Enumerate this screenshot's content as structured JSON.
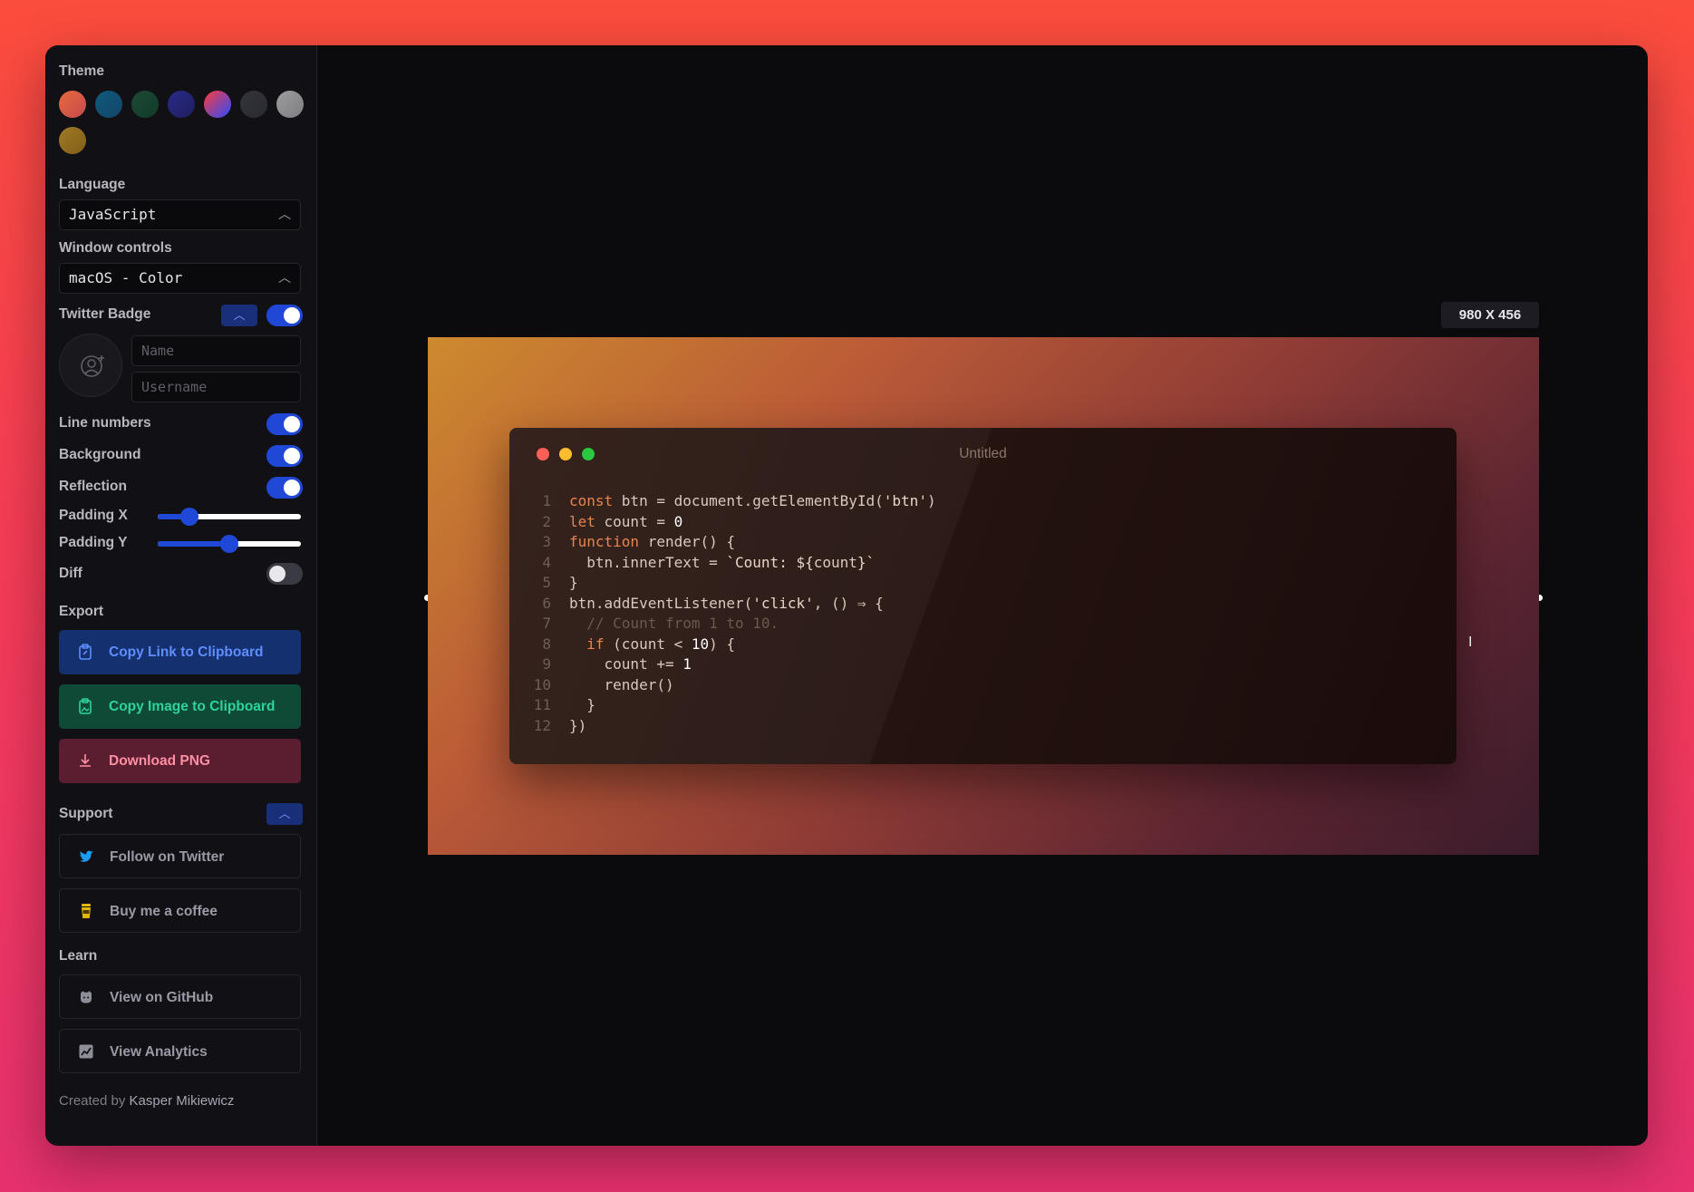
{
  "sidebar": {
    "theme_label": "Theme",
    "theme_swatches": [
      {
        "name": "candy",
        "colors": [
          "#e8693d",
          "#c54a4e"
        ]
      },
      {
        "name": "ocean",
        "colors": [
          "#0f5a7a",
          "#13456a"
        ]
      },
      {
        "name": "forest",
        "colors": [
          "#1c4a34",
          "#123a2a"
        ]
      },
      {
        "name": "midnight",
        "colors": [
          "#2a2a8a",
          "#1e1e5e"
        ]
      },
      {
        "name": "rainbow",
        "colors": [
          "#ff3b3b",
          "#2b4bff"
        ]
      },
      {
        "name": "slate",
        "colors": [
          "#33343a",
          "#2a2b30"
        ]
      },
      {
        "name": "silver",
        "colors": [
          "#9d9d9f",
          "#7e7e82"
        ]
      },
      {
        "name": "gold",
        "colors": [
          "#a07a27",
          "#7f5e18"
        ]
      }
    ],
    "language_label": "Language",
    "language_value": "JavaScript",
    "window_controls_label": "Window controls",
    "window_controls_value": "macOS - Color",
    "twitter_badge_label": "Twitter Badge",
    "name_placeholder": "Name",
    "username_placeholder": "Username",
    "line_numbers_label": "Line numbers",
    "background_label": "Background",
    "reflection_label": "Reflection",
    "padding_x_label": "Padding X",
    "padding_y_label": "Padding Y",
    "padding_x_value": 0.22,
    "padding_y_value": 0.5,
    "diff_label": "Diff",
    "export_label": "Export",
    "copy_link_label": "Copy Link to Clipboard",
    "copy_image_label": "Copy Image to Clipboard",
    "download_label": "Download PNG",
    "support_label": "Support",
    "follow_twitter_label": "Follow on Twitter",
    "coffee_label": "Buy me a coffee",
    "learn_label": "Learn",
    "github_label": "View on GitHub",
    "analytics_label": "View Analytics",
    "credit_prefix": "Created by",
    "credit_name": "Kasper Mikiewicz",
    "toggles": {
      "twitter_badge": true,
      "line_numbers": true,
      "background": true,
      "reflection": true,
      "diff": false
    }
  },
  "canvas": {
    "dimensions": "980 X 456",
    "window_title": "Untitled",
    "window_dots": [
      "#ff5f57",
      "#febc2e",
      "#28c840"
    ]
  },
  "code_lines": [
    {
      "n": "1",
      "html": [
        [
          "kw",
          "const "
        ],
        [
          "txt",
          "btn = document.getElementById("
        ],
        [
          "str",
          "'btn'"
        ],
        [
          "txt",
          ")"
        ]
      ]
    },
    {
      "n": "2",
      "html": [
        [
          "kw",
          "let "
        ],
        [
          "txt",
          "count = "
        ],
        [
          "num",
          "0"
        ]
      ]
    },
    {
      "n": "3",
      "html": [
        [
          "kw",
          "function "
        ],
        [
          "txt",
          "render() {"
        ]
      ]
    },
    {
      "n": "4",
      "html": [
        [
          "txt",
          "  btn.innerText = "
        ],
        [
          "str",
          "`Count: ${"
        ],
        [
          "txt",
          "count"
        ],
        [
          "str",
          "}`"
        ]
      ]
    },
    {
      "n": "5",
      "html": [
        [
          "txt",
          "}"
        ]
      ]
    },
    {
      "n": "6",
      "html": [
        [
          "txt",
          "btn.addEventListener("
        ],
        [
          "str",
          "'click'"
        ],
        [
          "txt",
          ", () ⇒ {"
        ]
      ]
    },
    {
      "n": "7",
      "html": [
        [
          "cmt",
          "  // Count from 1 to 10."
        ]
      ]
    },
    {
      "n": "8",
      "html": [
        [
          "kw",
          "  if "
        ],
        [
          "txt",
          "(count < "
        ],
        [
          "num",
          "10"
        ],
        [
          "txt",
          ") {"
        ]
      ]
    },
    {
      "n": "9",
      "html": [
        [
          "txt",
          "    count += "
        ],
        [
          "num",
          "1"
        ]
      ]
    },
    {
      "n": "10",
      "html": [
        [
          "txt",
          "    render()"
        ]
      ]
    },
    {
      "n": "11",
      "html": [
        [
          "txt",
          "  }"
        ]
      ]
    },
    {
      "n": "12",
      "html": [
        [
          "txt",
          "})"
        ]
      ]
    }
  ]
}
